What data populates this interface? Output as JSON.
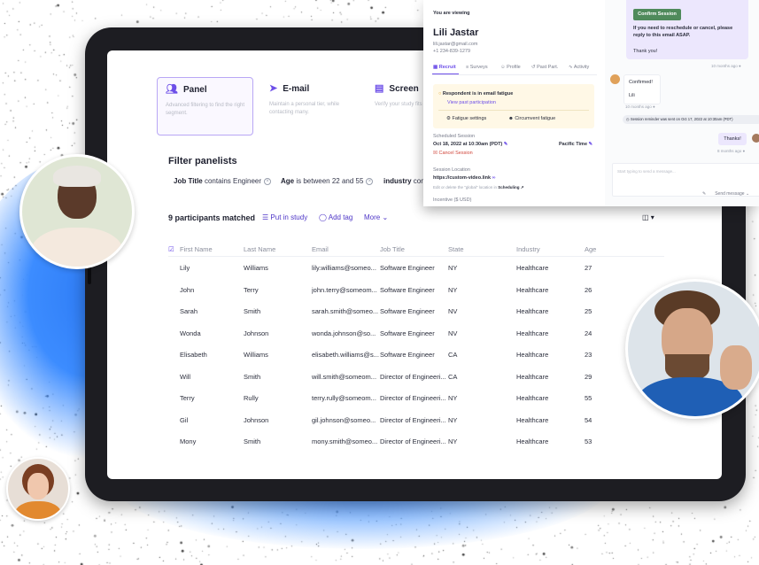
{
  "tabs": [
    {
      "label": "Panel",
      "desc": "Advanced filtering to find the right segment.",
      "icon": "users-icon",
      "active": true
    },
    {
      "label": "E-mail",
      "desc": "Maintain a personal tier, while contacting many.",
      "icon": "send-icon",
      "active": false
    },
    {
      "label": "Screen",
      "desc": "Verify your study fits perfect participants",
      "icon": "document-icon",
      "active": false
    }
  ],
  "filter": {
    "title": "Filter panelists",
    "chips": [
      {
        "field": "Job Title",
        "op": "contains",
        "value": "Engineer"
      },
      {
        "field": "Age",
        "op": "is between",
        "value": "22 and 55"
      },
      {
        "field": "industry",
        "op": "con",
        "value": ""
      }
    ]
  },
  "results": {
    "matched": "9 participants matched",
    "actions": [
      "Put in study",
      "Add tag",
      "More"
    ]
  },
  "table": {
    "columns": [
      "First Name",
      "Last Name",
      "Email",
      "Job Title",
      "State",
      "Industry",
      "Age"
    ],
    "rows": [
      [
        "Lily",
        "Williams",
        "lily.williams@someo...",
        "Software Engineer",
        "NY",
        "Healthcare",
        "27"
      ],
      [
        "John",
        "Terry",
        "john.terry@someom...",
        "Software Engineer",
        "NY",
        "Healthcare",
        "26"
      ],
      [
        "Sarah",
        "Smith",
        "sarah.smith@someo...",
        "Software Engineer",
        "NV",
        "Healthcare",
        "25"
      ],
      [
        "Wonda",
        "Johnson",
        "wonda.johnson@so...",
        "Software Engineer",
        "NV",
        "Healthcare",
        "24"
      ],
      [
        "Elisabeth",
        "Williams",
        "elisabeth.williams@s...",
        "Software Engineer",
        "CA",
        "Healthcare",
        "23"
      ],
      [
        "Will",
        "Smith",
        "will.smith@someom...",
        "Director of Engineeri...",
        "CA",
        "Healthcare",
        "29"
      ],
      [
        "Terry",
        "Rully",
        "terry.rully@someom...",
        "Director of Engineeri...",
        "NY",
        "Healthcare",
        "55"
      ],
      [
        "Gil",
        "Johnson",
        "gil.johnson@someo...",
        "Director of Engineeri...",
        "NY",
        "Healthcare",
        "54"
      ],
      [
        "Mony",
        "Smith",
        "mony.smith@someo...",
        "Director of Engineeri...",
        "NY",
        "Healthcare",
        "53"
      ]
    ]
  },
  "profile": {
    "viewing_label": "You are viewing",
    "name": "Lili Jastar",
    "email": "lili.jastar@gmail.com",
    "phone": "+1 234-839-1279",
    "tabs": [
      "Recruit",
      "Surveys",
      "Profile",
      "Past Part.",
      "Activity"
    ],
    "fatigue_title": "Respondent is in email fatigue",
    "fatigue_link": "View past participation",
    "fatigue_settings": "Fatigue settings",
    "circumvent": "Circumvent fatigue",
    "scheduled_label": "Scheduled Session",
    "scheduled_value": "Oct 18, 2022 at 10:30am (PDT)",
    "timezone": "Pacific Time",
    "cancel": "Cancel Session",
    "location_label": "Session Location",
    "location_value": "https://custom-video.link",
    "location_hint": "Edit or delete the \"global\" location in",
    "location_hint_link": "Scheduling ↗",
    "incentive": "Incentive ($ USD)"
  },
  "chat": {
    "confirm_button": "Confirm Session",
    "message1": "If you need to reschedule or cancel, please reply to this email ASAP.",
    "message1_thanks": "Thank you!",
    "time1": "10 months ago",
    "reply_title": "Confirmed!",
    "reply_name": "Lili",
    "time2": "10 months ago",
    "system_notice": "Session reminder was sent on Oct 17, 2022 at 10:30am (PDT)",
    "thanks": "Thanks!",
    "time3": "8 months ago",
    "input_placeholder": "Start typing to send a message...",
    "send_label": "Send message"
  },
  "colors": {
    "accent": "#6d4fe8",
    "blue_glow": "#2f7df6",
    "confirm_green": "#4f8a5b",
    "fatigue_bg": "#fff8e6"
  }
}
